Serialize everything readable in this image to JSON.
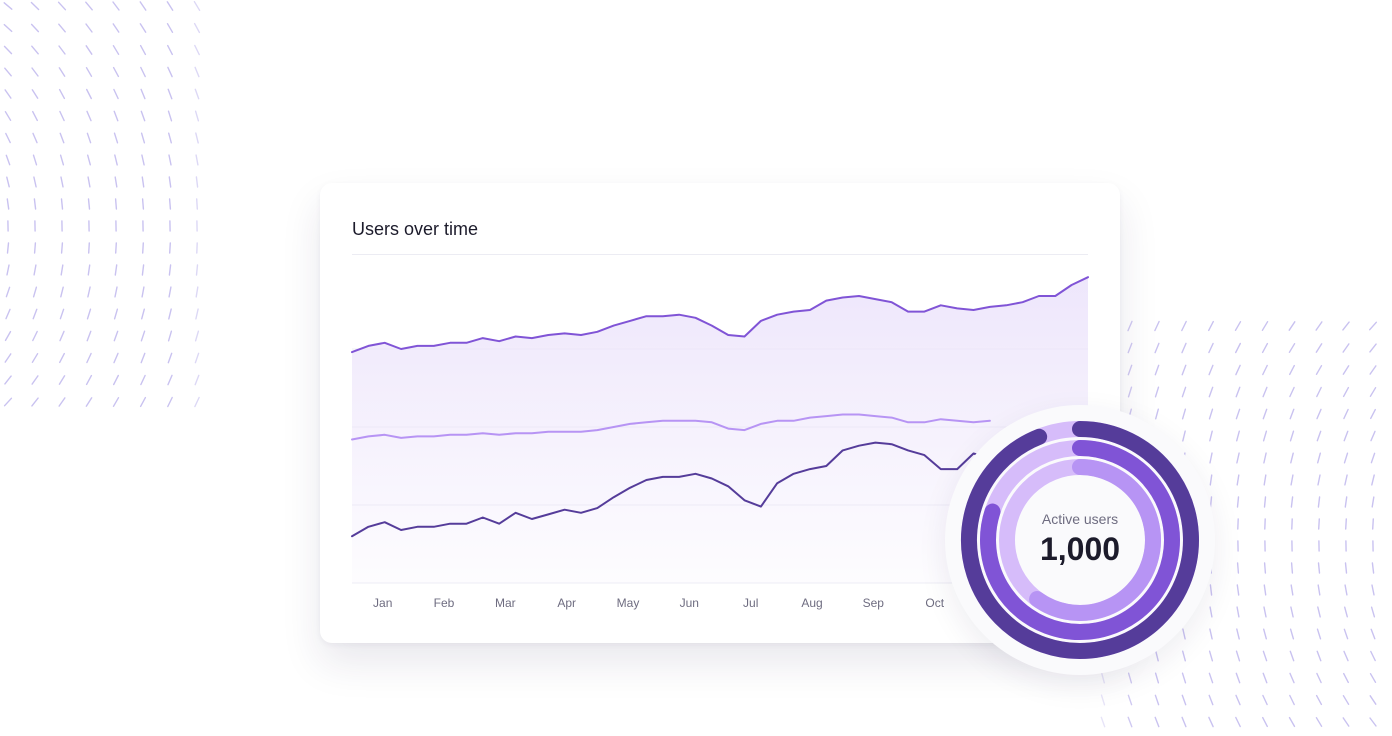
{
  "card": {
    "title": "Users over time"
  },
  "colors": {
    "dark": "#553c9a",
    "mid": "#8054d6",
    "light": "#b794f4",
    "fill": "#ede5fb",
    "pattern": "#c9c2f0",
    "ring_track": "#d6bcfa"
  },
  "chart_data": {
    "type": "line",
    "categories": [
      "Jan",
      "Feb",
      "Mar",
      "Apr",
      "May",
      "Jun",
      "Jul",
      "Aug",
      "Sep",
      "Oct"
    ],
    "grid": true,
    "series": [
      {
        "values": [
          148,
          152,
          154,
          150,
          152,
          152,
          154,
          154,
          157,
          155,
          158,
          157,
          159,
          160,
          159,
          161,
          165,
          168,
          171,
          171,
          172,
          170,
          165,
          159,
          158,
          168,
          172,
          174,
          175,
          181,
          183,
          184,
          182,
          180,
          174,
          174,
          178,
          176,
          175,
          177,
          178,
          180,
          184,
          184,
          191,
          196
        ]
      },
      {
        "values": [
          92,
          94,
          95,
          93,
          94,
          94,
          95,
          95,
          96,
          95,
          96,
          96,
          97,
          97,
          97,
          98,
          100,
          102,
          103,
          104,
          104,
          104,
          103,
          99,
          98,
          102,
          104,
          104,
          106,
          107,
          108,
          108,
          107,
          106,
          103,
          103,
          105,
          104,
          103,
          104
        ]
      },
      {
        "values": [
          30,
          36,
          39,
          34,
          36,
          36,
          38,
          38,
          42,
          38,
          45,
          41,
          44,
          47,
          45,
          48,
          55,
          61,
          66,
          68,
          68,
          70,
          67,
          62,
          53,
          49,
          64,
          70,
          73,
          75,
          85,
          88,
          90,
          89,
          85,
          82,
          73,
          73,
          83,
          80
        ]
      }
    ]
  },
  "donut": {
    "label": "Active users",
    "value": "1,000",
    "rings": [
      {
        "fraction": 0.94
      },
      {
        "fraction": 0.8
      },
      {
        "fraction": 0.6
      }
    ]
  }
}
